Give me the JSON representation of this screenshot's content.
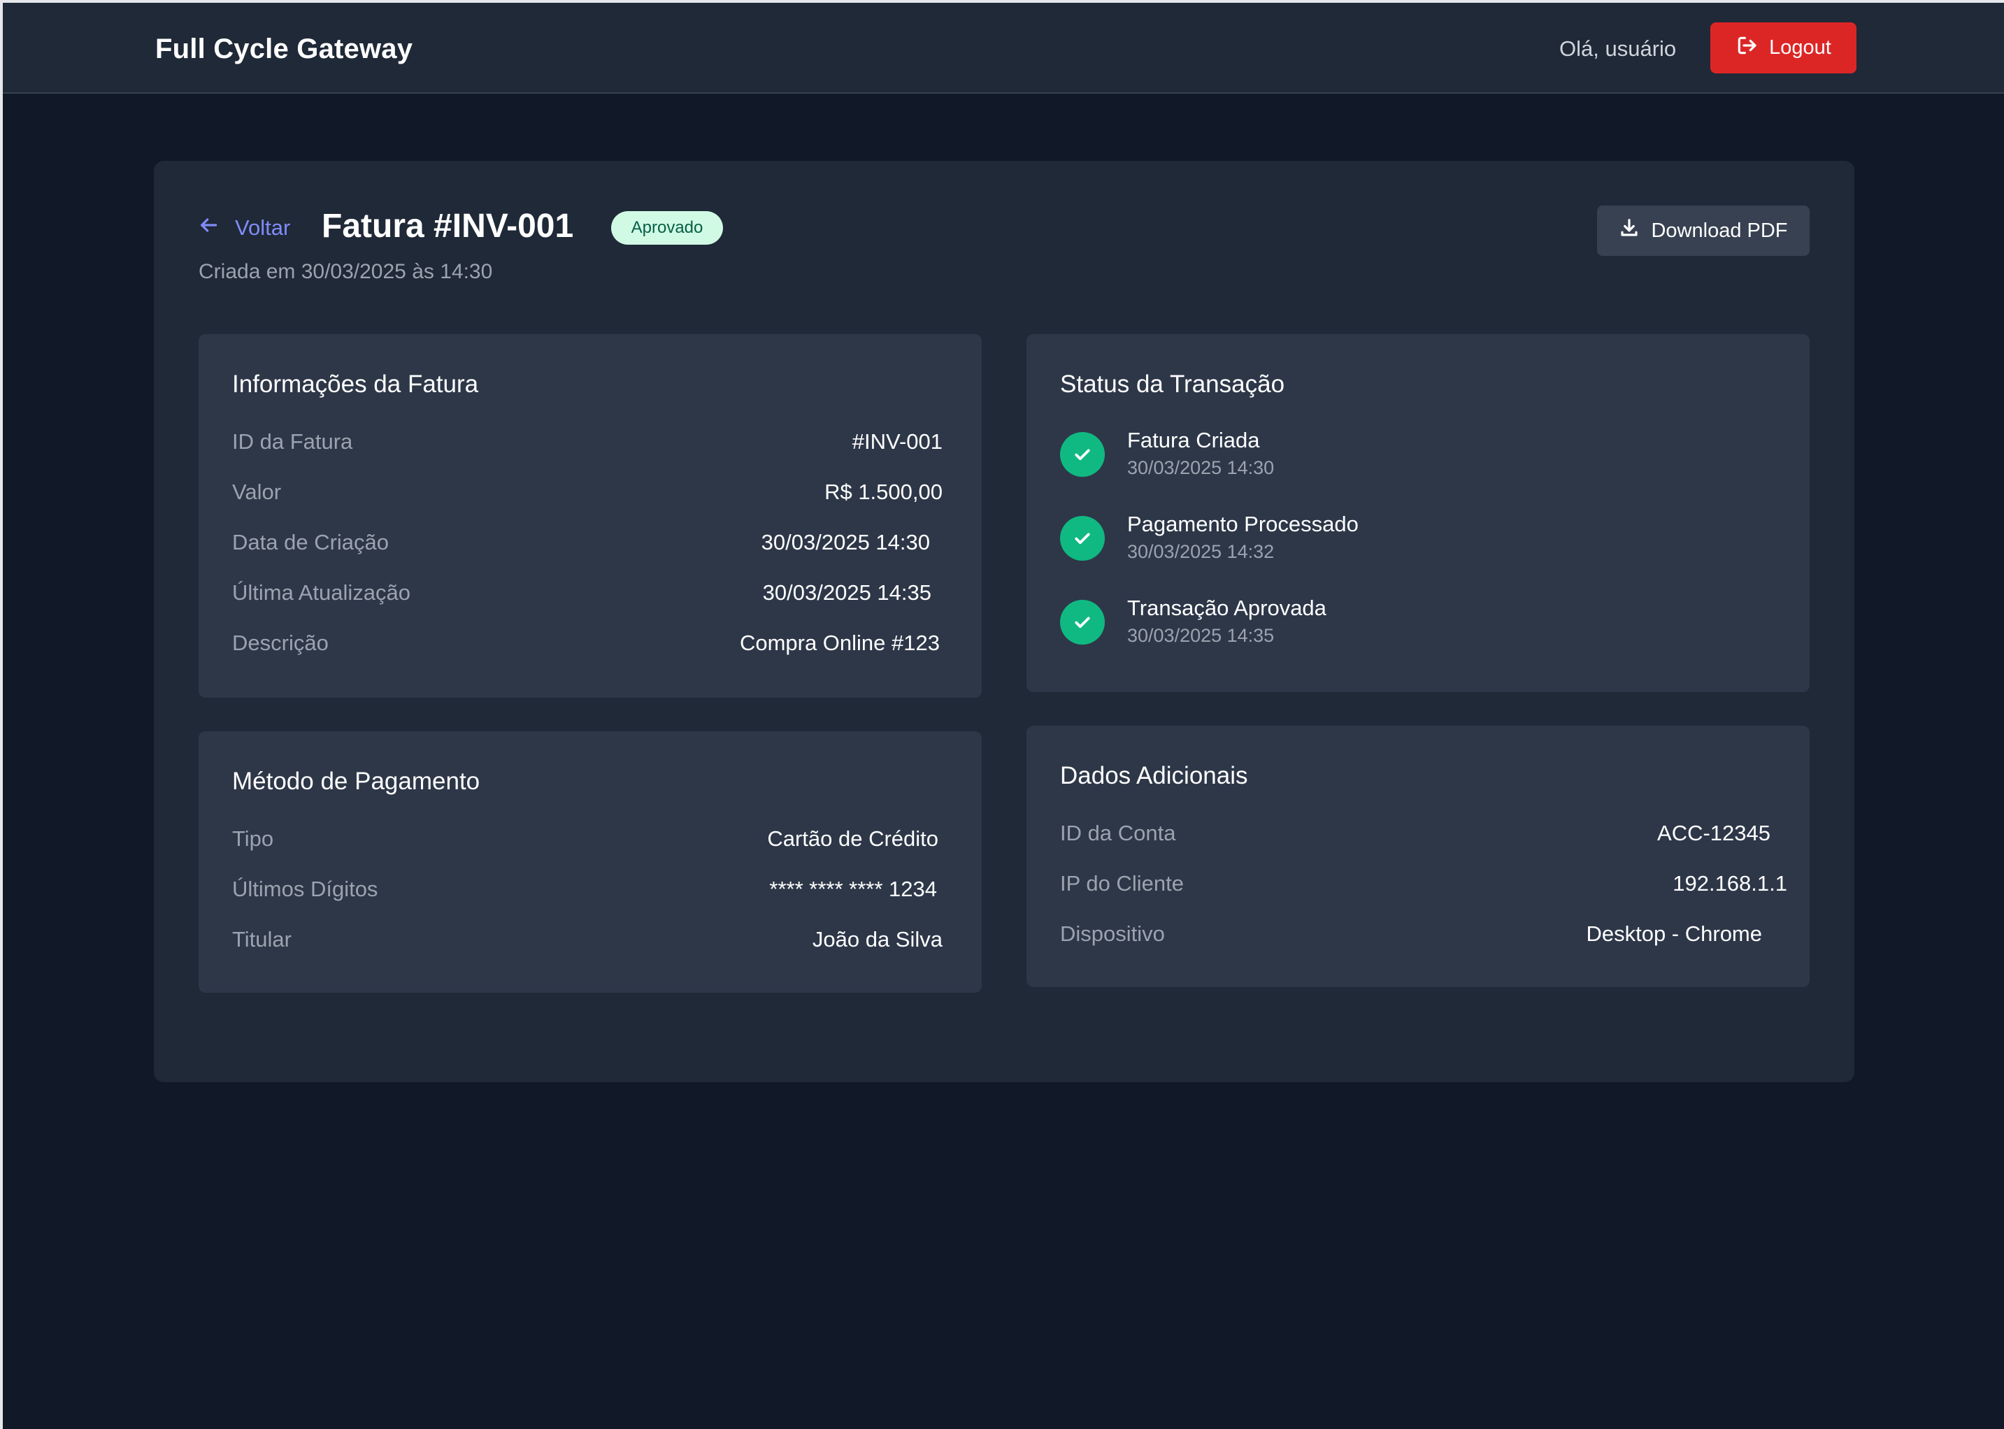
{
  "header": {
    "brand": "Full Cycle Gateway",
    "greeting": "Olá, usuário",
    "logout_label": "Logout"
  },
  "invoice": {
    "back_label": "Voltar",
    "title": "Fatura #INV-001",
    "status_badge": "Aprovado",
    "created_text": "Criada em 30/03/2025 às 14:30",
    "download_label": "Download PDF"
  },
  "info_card": {
    "title": "Informações da Fatura",
    "rows": [
      {
        "label": "ID da Fatura",
        "value": "#INV-001"
      },
      {
        "label": "Valor",
        "value": "R$ 1.500,00"
      },
      {
        "label": "Data de Criação",
        "value": "30/03/2025 14:30"
      },
      {
        "label": "Última Atualização",
        "value": "30/03/2025 14:35"
      },
      {
        "label": "Descrição",
        "value": "Compra Online #123"
      }
    ]
  },
  "status_card": {
    "title": "Status da Transação",
    "steps": [
      {
        "title": "Fatura Criada",
        "time": "30/03/2025 14:30"
      },
      {
        "title": "Pagamento Processado",
        "time": "30/03/2025 14:32"
      },
      {
        "title": "Transação Aprovada",
        "time": "30/03/2025 14:35"
      }
    ]
  },
  "payment_card": {
    "title": "Método de Pagamento",
    "rows": [
      {
        "label": "Tipo",
        "value": "Cartão de Crédito"
      },
      {
        "label": "Últimos Dígitos",
        "value": "**** **** **** 1234"
      },
      {
        "label": "Titular",
        "value": "João da Silva"
      }
    ]
  },
  "extra_card": {
    "title": "Dados Adicionais",
    "rows": [
      {
        "label": "ID da Conta",
        "value": "ACC-12345"
      },
      {
        "label": "IP do Cliente",
        "value": "192.168.1.1"
      },
      {
        "label": "Dispositivo",
        "value": "Desktop - Chrome"
      }
    ]
  },
  "colors": {
    "background": "#111827",
    "header": "#1f2937",
    "panel": "#1f2937",
    "card": "#2d3748",
    "accent_link": "#818cf8",
    "logout": "#dc2626",
    "success": "#10b981",
    "badge_bg": "#d1fae5",
    "badge_text": "#065f46"
  },
  "icons": {
    "back": "arrow-left-icon",
    "logout": "sign-out-icon",
    "download": "download-icon",
    "step": "check-circle-icon"
  }
}
